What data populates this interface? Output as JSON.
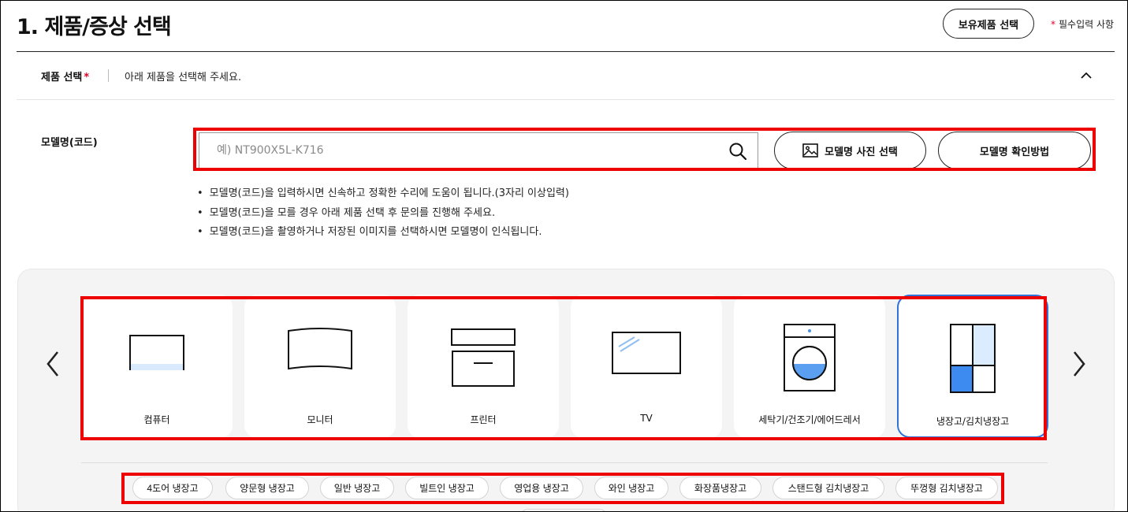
{
  "header": {
    "title": "1. 제품/증상 선택",
    "owned_button": "보유제품 선택",
    "required_star": "*",
    "required_note": "필수입력 사항"
  },
  "product_section": {
    "label": "제품 선택",
    "required_star": "*",
    "description": "아래 제품을 선택해 주세요.",
    "collapse_icon": "chevron-up-icon"
  },
  "model": {
    "label": "모델명(코드)",
    "placeholder": "예) NT900X5L-K716",
    "value": "",
    "photo_button": "모델명 사진 선택",
    "howto_button": "모델명 확인방법",
    "notes": [
      "모델명(코드)을 입력하시면 신속하고 정확한 수리에 도움이 됩니다.(3자리 이상입력)",
      "모델명(코드)을 모를 경우 아래 제품 선택 후 문의를 진행해 주세요.",
      "모델명(코드)을 촬영하거나 저장된 이미지를 선택하시면 모델명이 인식됩니다."
    ]
  },
  "categories": [
    {
      "label": "컴퓨터",
      "icon": "laptop-icon"
    },
    {
      "label": "모니터",
      "icon": "monitor-icon"
    },
    {
      "label": "프린터",
      "icon": "printer-icon"
    },
    {
      "label": "TV",
      "icon": "tv-icon"
    },
    {
      "label": "세탁기/건조기/에어드레서",
      "icon": "washer-icon"
    },
    {
      "label": "냉장고/김치냉장고",
      "icon": "refrigerator-icon",
      "selected": true
    }
  ],
  "subcategories": [
    "4도어 냉장고",
    "양문형 냉장고",
    "일반 냉장고",
    "빌트인 냉장고",
    "영업용 냉장고",
    "와인 냉장고",
    "화장품냉장고",
    "스탠드형 김치냉장고",
    "뚜껑형 김치냉장고"
  ],
  "colors": {
    "accent_blue": "#2f73d9",
    "highlight_red": "#ee0000",
    "required_red": "#e0002a",
    "panel_bg": "#f4f4f4"
  }
}
